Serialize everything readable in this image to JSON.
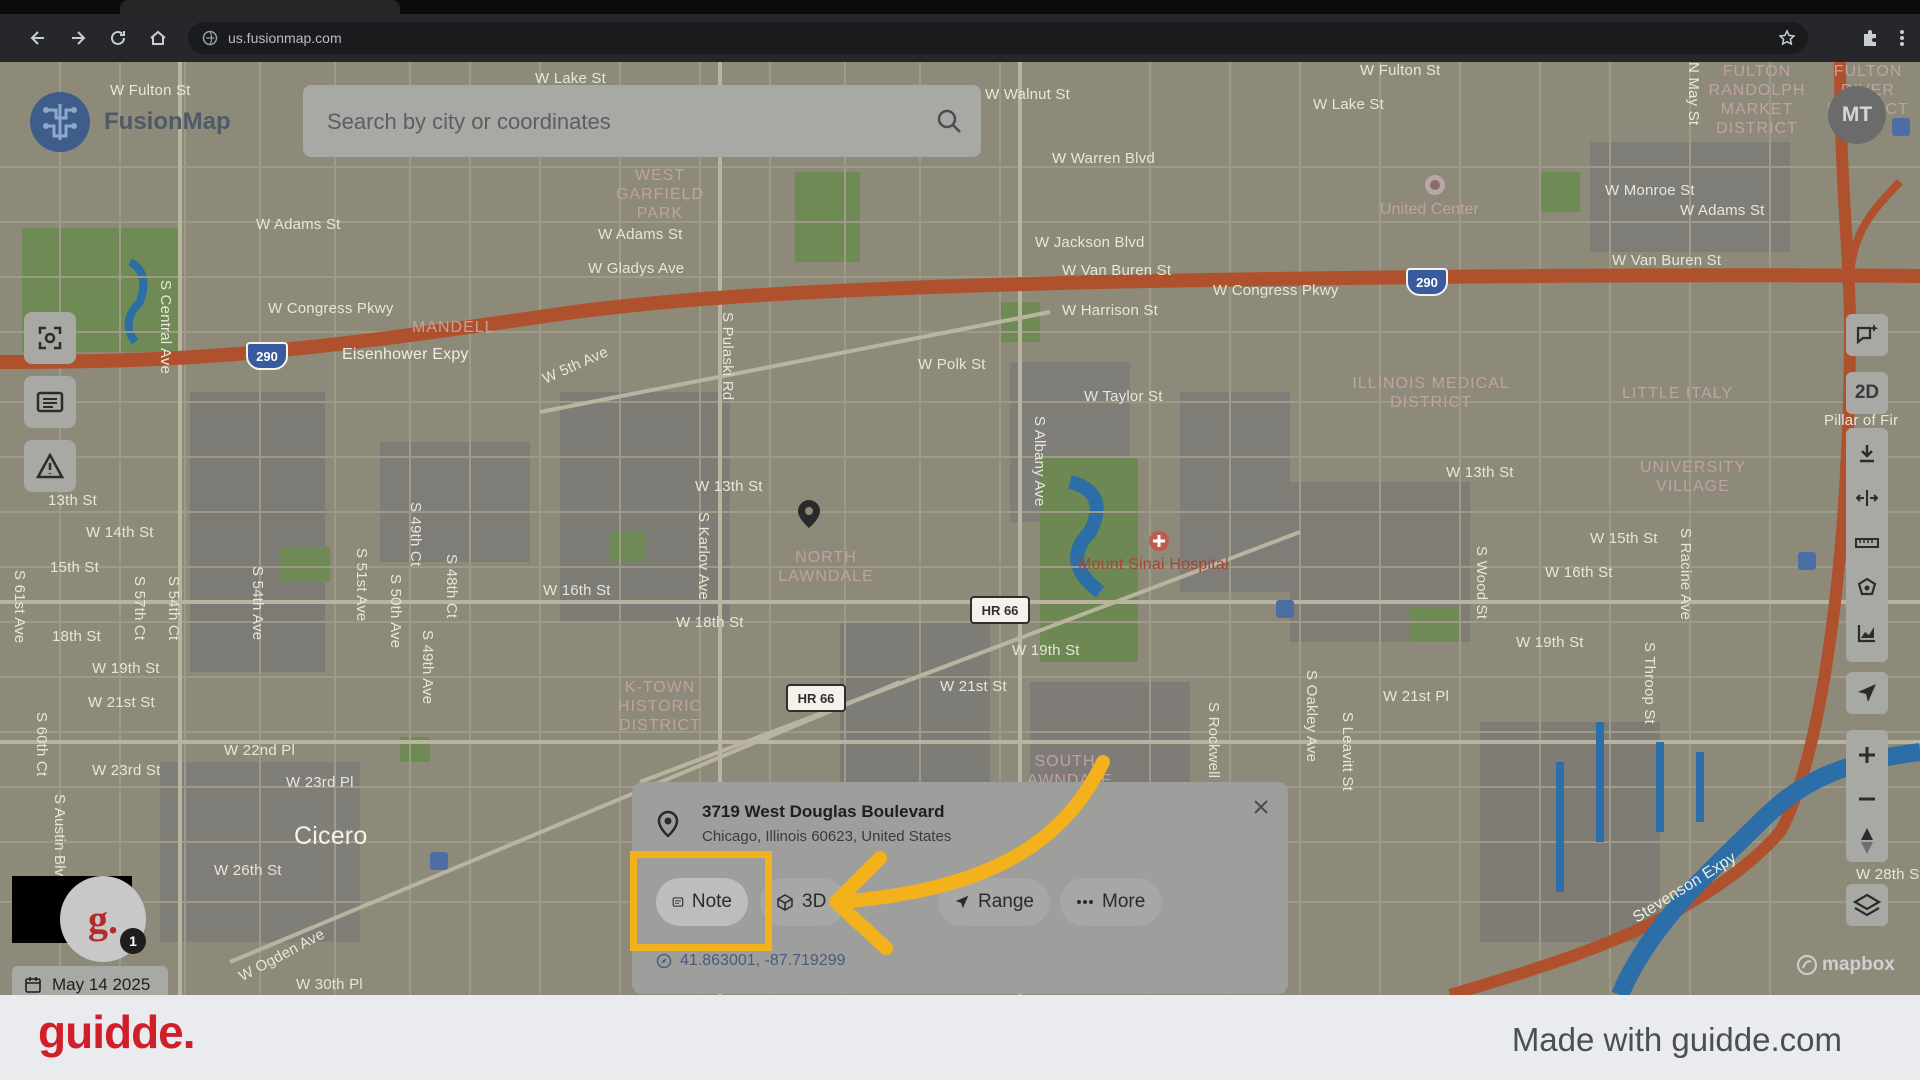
{
  "browser": {
    "url": "us.fusionmap.com"
  },
  "app": {
    "logo_text": "FusionMap",
    "search_placeholder": "Search by city or coordinates",
    "avatar_initials": "MT",
    "view_mode": "2D",
    "date": "May 14 2025",
    "guidde_count": "1"
  },
  "map": {
    "streets": [
      "W Fulton St",
      "W Lake St",
      "W Walnut St",
      "W Fulton St",
      "W Lake St",
      "W Warren Blvd",
      "W Monroe St",
      "W Adams St",
      "W Adams St",
      "W Adams St",
      "W Gladys Ave",
      "W Jackson Blvd",
      "W Van Buren St",
      "W Van Buren St",
      "W Congress Pkwy",
      "W Congress Pkwy",
      "W Harrison St",
      "Eisenhower Expy",
      "W 5th Ave",
      "W Polk St",
      "W Taylor St",
      "W 13th St",
      "W 13th St",
      "13th St",
      "W 14th St",
      "15th St",
      "W 15th St",
      "W 16th St",
      "W 16th St",
      "18th St",
      "W 18th St",
      "W 19th St",
      "W 19th St",
      "W 19th St",
      "W 21st St",
      "W 21st St",
      "W 21st Pl",
      "W 22nd Pl",
      "W 23rd St",
      "W 23rd Pl",
      "W 26th St",
      "W Ogden Ave",
      "W 30th Pl",
      "W 28th St",
      "Stevenson Expy",
      "S Central Ave",
      "S Pulaski Rd",
      "S Albany Ave",
      "S Karlov Ave",
      "S 54th Ave",
      "S 51st Ave",
      "S 50th Ave",
      "S 49th Ct",
      "S 48th Ct",
      "S 49th Ave",
      "S 57th Ct",
      "S 54th Ct",
      "S 61st Ave",
      "S 60th Ct",
      "S Austin Blvd",
      "S Rockwell",
      "S Oakley Ave",
      "S Leavitt St",
      "S Wood St",
      "S Throop St",
      "S Racine Ave",
      "N May St",
      "Pillar of Fir"
    ],
    "areas": [
      "WEST GARFIELD PARK",
      "MANDELL",
      "NORTH LAWNDALE",
      "K-TOWN HISTORIC DISTRICT",
      "SOUTH LAWNDALE",
      "ILLINOIS MEDICAL DISTRICT",
      "LITTLE ITALY",
      "UNIVERSITY VILLAGE",
      "FULTON RANDOLPH MARKET DISTRICT",
      "FULTON RIVER DISTRICT"
    ],
    "pois": [
      "United Center",
      "Mount Sinai Hospital"
    ],
    "city": "Cicero",
    "highway_shields": [
      "290",
      "290",
      "HR 66",
      "HR 66"
    ],
    "attribution": "mapbox"
  },
  "popup": {
    "title": "3719 West Douglas Boulevard",
    "subtitle": "Chicago, Illinois 60623, United States",
    "buttons": {
      "note": "Note",
      "three_d": "3D",
      "range": "Range",
      "more": "More"
    },
    "coordinates": "41.863001, -87.719299"
  },
  "footer": {
    "brand": "guidde.",
    "made_with": "Made with guidde.com"
  }
}
